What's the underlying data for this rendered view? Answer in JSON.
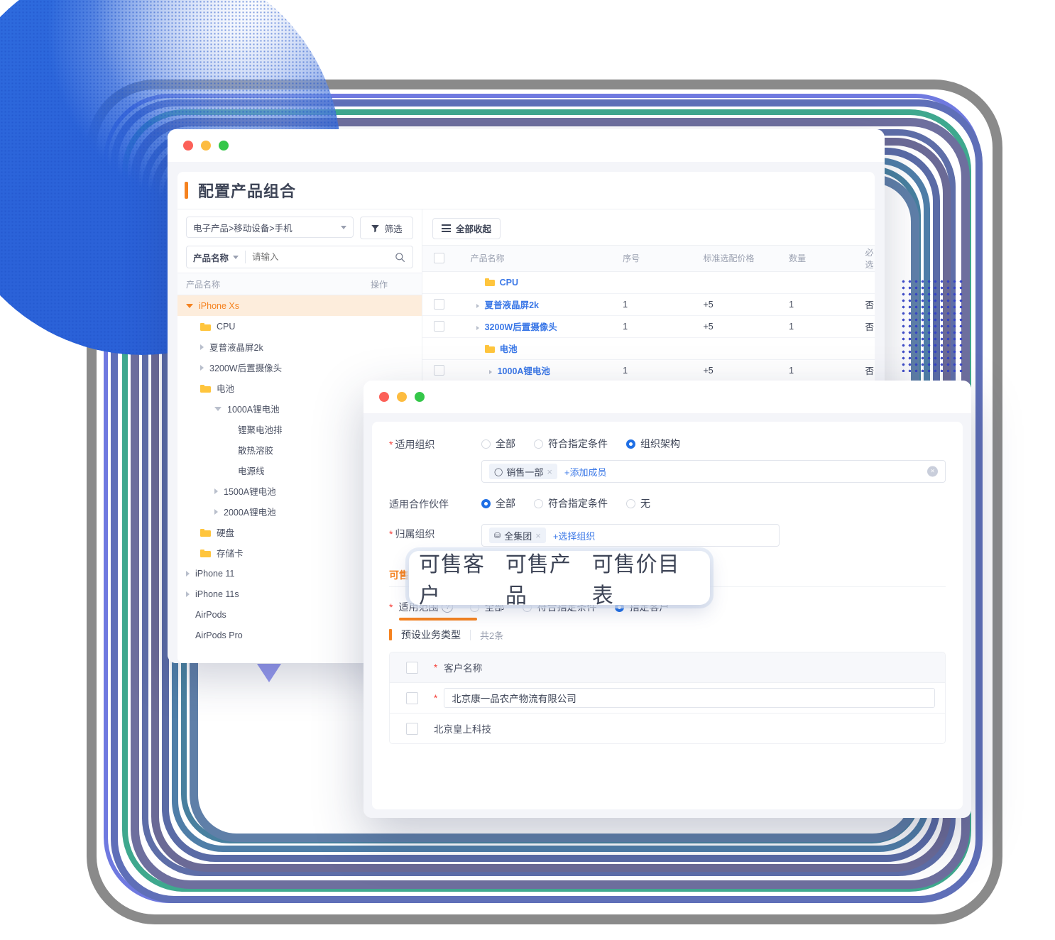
{
  "colors": {
    "accent_orange": "#f5821f",
    "link_blue": "#3b78e7",
    "radio_blue": "#1f6fe5",
    "required_red": "#f5413b",
    "folder_yellow": "#ffc53d",
    "circle_blue": "#2b63d9"
  },
  "window1": {
    "traffic_lights": [
      "close-red",
      "minimize-yellow",
      "maximize-green"
    ],
    "page_title": "配置产品组合",
    "filters": {
      "category_select_value": "电子产品>移动设备>手机",
      "filter_button_label": "筛选",
      "search_field_label": "产品名称",
      "search_placeholder": "请输入"
    },
    "tree": {
      "header": {
        "name": "产品名称",
        "action": "操作"
      },
      "nodes": [
        {
          "label": "iPhone Xs",
          "indent": 1,
          "icon": "caret-down",
          "selected": true
        },
        {
          "label": "CPU",
          "indent": 2,
          "icon": "folder",
          "selected": false
        },
        {
          "label": "夏普液晶屏2k",
          "indent": 2,
          "icon": "caret-right",
          "selected": false
        },
        {
          "label": "3200W后置摄像头",
          "indent": 2,
          "icon": "caret-right",
          "selected": false
        },
        {
          "label": "电池",
          "indent": 2,
          "icon": "folder",
          "selected": false
        },
        {
          "label": "1000A锂电池",
          "indent": 3,
          "icon": "caret-down-grey",
          "selected": false
        },
        {
          "label": "锂聚电池排",
          "indent": 4,
          "icon": "none",
          "selected": false
        },
        {
          "label": "散热溶胶",
          "indent": 4,
          "icon": "none",
          "selected": false
        },
        {
          "label": "电源线",
          "indent": 4,
          "icon": "none",
          "selected": false
        },
        {
          "label": "1500A锂电池",
          "indent": 3,
          "icon": "caret-right",
          "selected": false
        },
        {
          "label": "2000A锂电池",
          "indent": 3,
          "icon": "caret-right",
          "selected": false
        },
        {
          "label": "硬盘",
          "indent": 2,
          "icon": "folder",
          "selected": false
        },
        {
          "label": "存储卡",
          "indent": 2,
          "icon": "folder",
          "selected": false
        },
        {
          "label": "iPhone 11",
          "indent": 1,
          "icon": "caret-right",
          "selected": false
        },
        {
          "label": "iPhone 11s",
          "indent": 1,
          "icon": "caret-right",
          "selected": false
        },
        {
          "label": "AirPods",
          "indent": 1,
          "icon": "none",
          "selected": false
        },
        {
          "label": "AirPods Pro",
          "indent": 1,
          "icon": "none",
          "selected": false
        }
      ]
    },
    "collapse_all_label": "全部收起",
    "table": {
      "columns": [
        "产品名称",
        "序号",
        "标准选配价格",
        "数量",
        "必选"
      ],
      "rows": [
        {
          "checkbox": false,
          "type": "folder",
          "name": "CPU",
          "seq": "",
          "price": "",
          "qty": "",
          "required": ""
        },
        {
          "checkbox": true,
          "type": "item",
          "name": "夏普液晶屏2k",
          "seq": "1",
          "price": "+5",
          "qty": "1",
          "required": "否"
        },
        {
          "checkbox": true,
          "type": "item",
          "name": "3200W后置摄像头",
          "seq": "1",
          "price": "+5",
          "qty": "1",
          "required": "否"
        },
        {
          "checkbox": false,
          "type": "folder",
          "name": "电池",
          "seq": "",
          "price": "",
          "qty": "",
          "required": ""
        },
        {
          "checkbox": true,
          "type": "subitem",
          "name": "1000A锂电池",
          "seq": "1",
          "price": "+5",
          "qty": "1",
          "required": "否"
        }
      ]
    }
  },
  "window2": {
    "traffic_lights": [
      "close-red",
      "minimize-yellow",
      "maximize-green"
    ],
    "form": {
      "org_scope": {
        "label": "适用组织",
        "required": true,
        "options": [
          "全部",
          "符合指定条件",
          "组织架构"
        ],
        "selected": "组织架构",
        "tag": "销售一部",
        "add_link": "添加成员"
      },
      "partner_scope": {
        "label": "适用合作伙伴",
        "required": false,
        "options": [
          "全部",
          "符合指定条件",
          "无"
        ],
        "selected": "全部"
      },
      "owner_org": {
        "label": "归属组织",
        "required": true,
        "tag": "全集团",
        "add_link": "选择组织"
      }
    },
    "tabs": [
      {
        "label": "可售客户",
        "active": true
      },
      {
        "label": "可售产品",
        "active": false
      },
      {
        "label": "可售价目表",
        "active": false
      }
    ],
    "applicable_scope": {
      "label": "适用范围",
      "required": true,
      "options": [
        "全部",
        "符合指定条件",
        "指定客户"
      ],
      "selected": "指定客户"
    },
    "section": {
      "title": "预设业务类型",
      "count_label": "共2条"
    },
    "customer_table": {
      "header": {
        "name": "客户名称",
        "required": true
      },
      "rows": [
        {
          "checkbox": false,
          "required": true,
          "name": "北京康一品农产物流有限公司",
          "editing": true
        },
        {
          "checkbox": false,
          "required": false,
          "name": "北京皇上科技",
          "editing": false
        }
      ]
    }
  },
  "decoration": {
    "rings_description": "concentric-rounded-rect-rings",
    "ring_colors": [
      "#8a8a8a",
      "#6f79e0",
      "#5f6fb8",
      "#3fa88e",
      "#6e6f9e",
      "#5e6ea8",
      "#6b6a96",
      "#5a6ba6",
      "#4f7ea8",
      "#48809f",
      "#5f7fa8"
    ]
  }
}
